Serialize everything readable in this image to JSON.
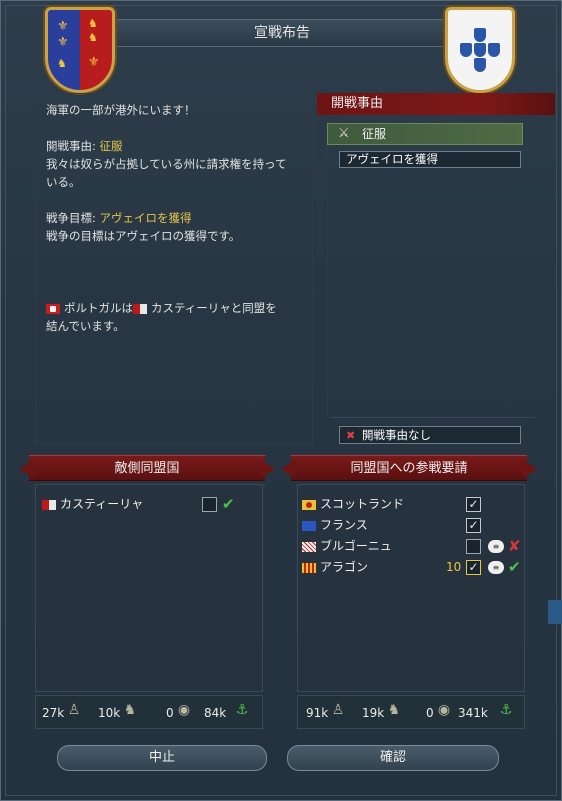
{
  "window": {
    "title": "宣戦布告"
  },
  "info": {
    "naval_warning": "海軍の一部が港外にいます！",
    "cb_label": "開戦事由: ",
    "cb_value": "征服",
    "cb_desc_1": "我々は奴らが占拠している州に請求権を持って",
    "cb_desc_2": "いる。",
    "goal_label": "戦争目標: ",
    "goal_value": "アヴェイロを獲得",
    "goal_desc": "戦争の目標はアヴェイロの獲得です。",
    "alliance_1a": "ポルトガルは",
    "alliance_1b": "カスティーリャと同盟を",
    "alliance_2": "結んでいます。"
  },
  "casus_belli": {
    "header": "開戦事由",
    "selected": "征服",
    "goal_option": "アヴェイロを獲得",
    "none_option": "開戦事由なし"
  },
  "enemy_allies": {
    "header": "敵側同盟国",
    "rows": [
      {
        "name": "カスティーリャ",
        "checked": false
      }
    ]
  },
  "call_allies": {
    "header": "同盟国への参戦要請",
    "rows": [
      {
        "name": "スコットランド",
        "checked": true
      },
      {
        "name": "フランス",
        "checked": true
      },
      {
        "name": "ブルゴーニュ",
        "checked": false
      },
      {
        "name": "アラゴン",
        "checked": true,
        "score": "10"
      }
    ]
  },
  "stats_left": {
    "infantry": "27k",
    "cavalry": "10k",
    "artillery": "0",
    "ships": "84k"
  },
  "stats_right": {
    "infantry": "91k",
    "cavalry": "19k",
    "artillery": "0",
    "ships": "341k"
  },
  "buttons": {
    "cancel": "中止",
    "confirm": "確認"
  },
  "colors": {
    "ribbon_red": "#7a1a1a",
    "cb_green": "#4e6b45",
    "accent_yellow": "#e6c846",
    "ok_green": "#4ec24e",
    "no_red": "#d23838"
  }
}
